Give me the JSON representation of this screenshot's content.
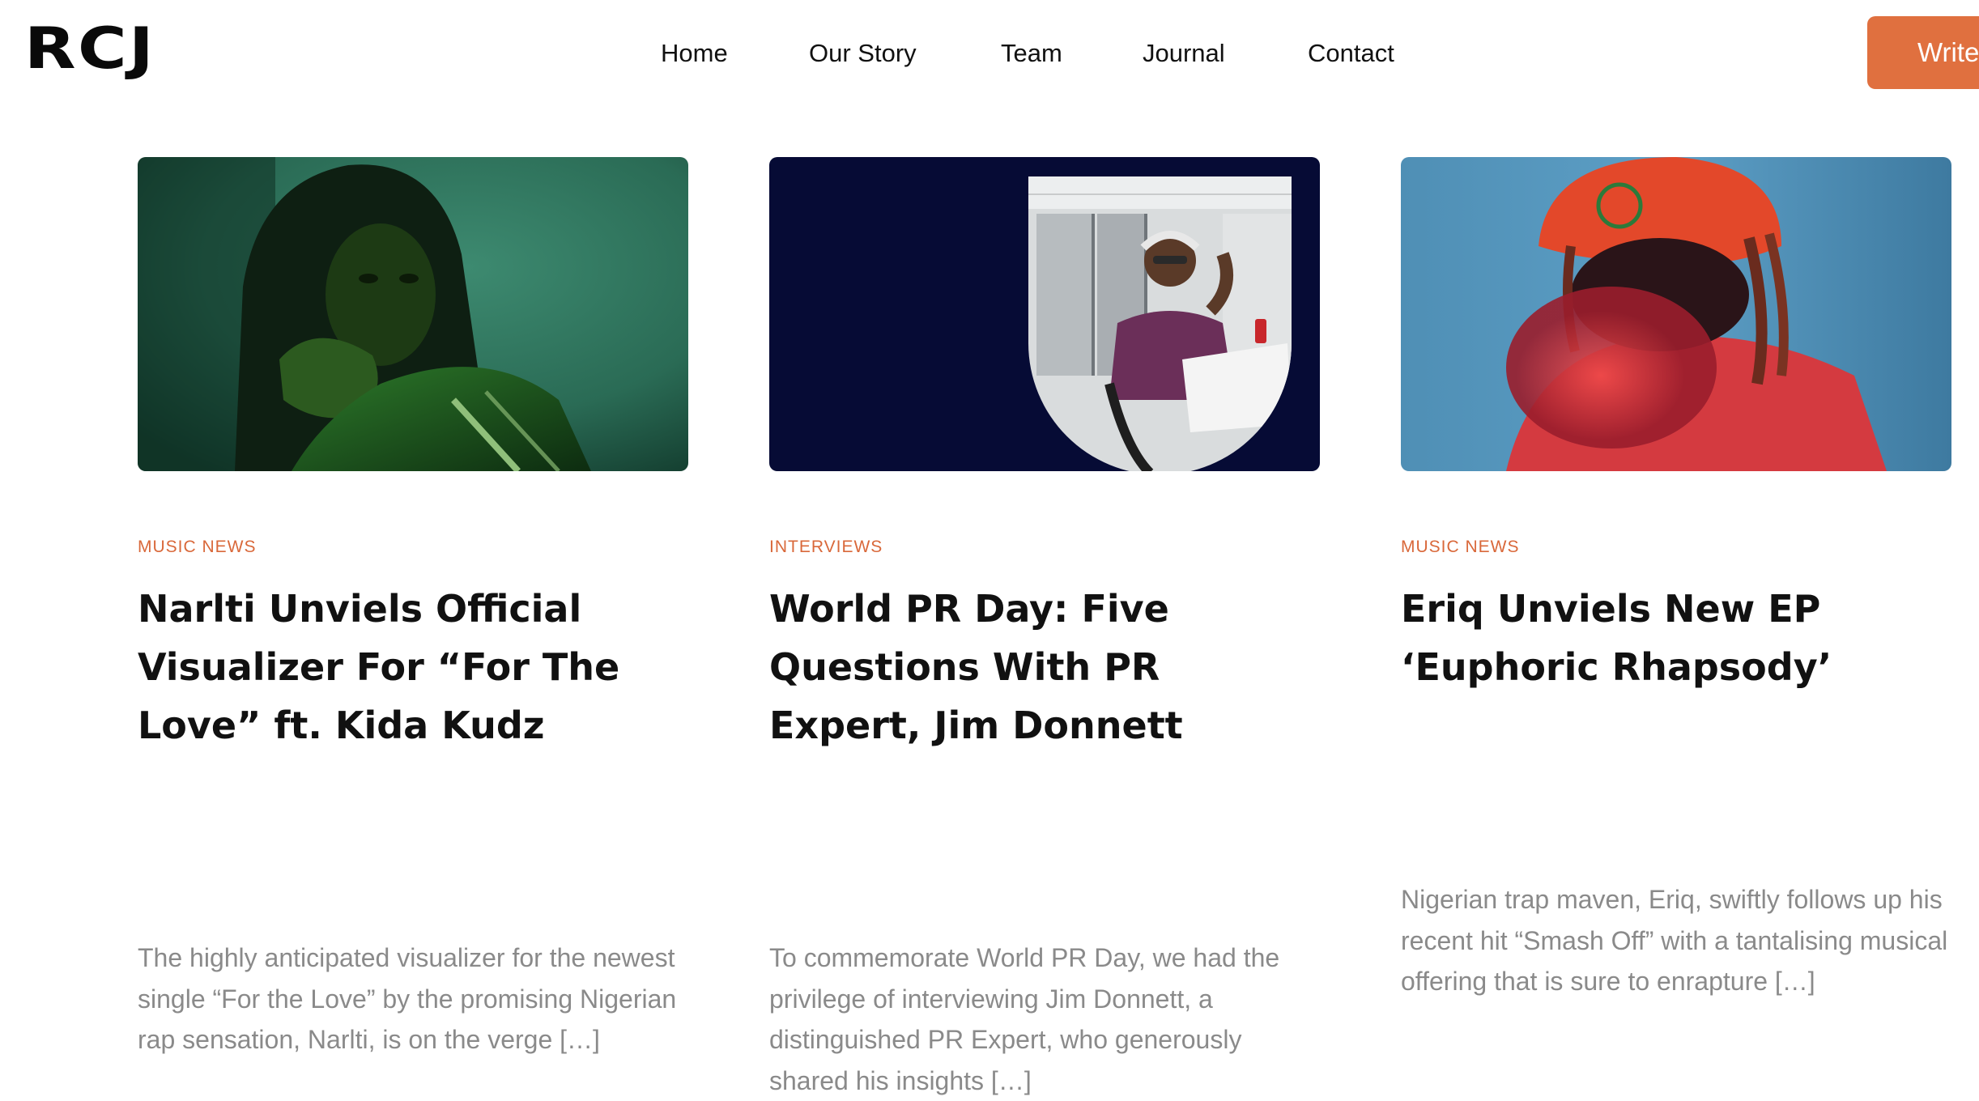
{
  "brand": {
    "logo_text": "RCJ",
    "accent_color": "#e0703f"
  },
  "nav": {
    "items": [
      {
        "label": "Home"
      },
      {
        "label": "Our Story"
      },
      {
        "label": "Team"
      },
      {
        "label": "Journal"
      },
      {
        "label": "Contact"
      }
    ],
    "cta_label": "Write"
  },
  "posts": [
    {
      "category": "MUSIC NEWS",
      "title": "Narlti Unviels Official Visualizer For “For The Love” ft. Kida Kudz",
      "excerpt": "The highly anticipated visualizer for the newest single “For the Love” by the promising Nigerian rap sensation, Narlti, is on the verge […]"
    },
    {
      "category": "INTERVIEWS",
      "title": "World PR Day: Five Questions With PR Expert, Jim Donnett",
      "excerpt": "To commemorate World PR Day, we had the privilege of interviewing Jim Donnett, a distinguished PR Expert, who generously shared his insights […]"
    },
    {
      "category": "MUSIC NEWS",
      "title": "Eriq Unviels New EP ‘Euphoric Rhapsody’",
      "excerpt": "Nigerian trap maven, Eriq, swiftly follows up his recent hit “Smash Off” with a tantalising musical offering that is sure to enrapture […]"
    }
  ]
}
